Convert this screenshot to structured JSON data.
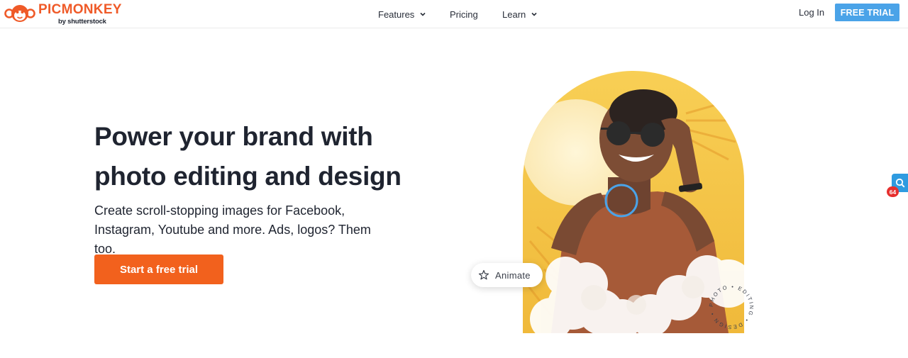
{
  "header": {
    "brand": {
      "name": "PICMONKEY",
      "tagline": "by shutterstock"
    },
    "nav": [
      {
        "label": "Features",
        "has_dropdown": true
      },
      {
        "label": "Pricing",
        "has_dropdown": false
      },
      {
        "label": "Learn",
        "has_dropdown": true
      }
    ],
    "login_label": "Log In",
    "free_trial_label": "FREE TRIAL"
  },
  "hero": {
    "headline_line1": "Power your brand with",
    "headline_line2": "photo editing and design",
    "subtext_line1": "Create scroll-stopping images for Facebook,",
    "subtext_line2": "Instagram, Youtube and more. Ads, logos? Them too.",
    "cta_label": "Start a free trial",
    "animate_chip_label": "Animate",
    "badge_text": "PHOTO • EDITING • DESIGN •"
  },
  "side_widget": {
    "count": "64",
    "icon": "search-icon"
  },
  "colors": {
    "brand_orange": "#ef5a28",
    "cta_orange": "#f2611d",
    "trial_blue": "#4aa3e8",
    "text_dark": "#1f2430"
  }
}
